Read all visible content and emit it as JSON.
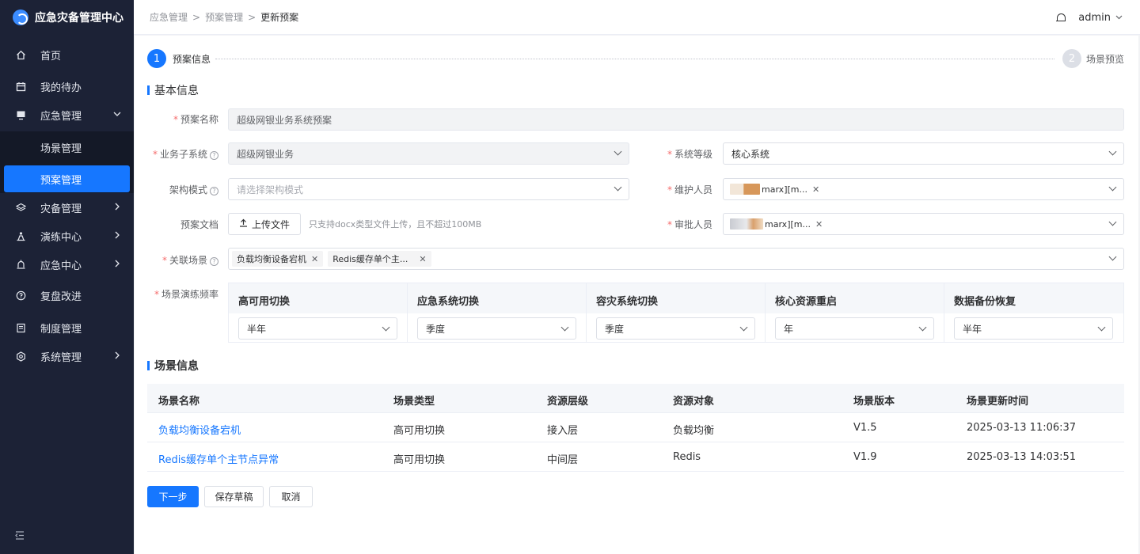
{
  "app": {
    "title": "应急灾备管理中心"
  },
  "sidebar": {
    "items": [
      {
        "label": "首页",
        "icon": "home-icon"
      },
      {
        "label": "我的待办",
        "icon": "calendar-icon"
      },
      {
        "label": "应急管理",
        "icon": "monitor-icon",
        "expanded": true
      },
      {
        "label": "灾备管理",
        "icon": "layers-icon"
      },
      {
        "label": "演练中心",
        "icon": "drill-icon"
      },
      {
        "label": "应急中心",
        "icon": "alarm-icon"
      },
      {
        "label": "复盘改进",
        "icon": "question-icon"
      },
      {
        "label": "制度管理",
        "icon": "document-icon"
      },
      {
        "label": "系统管理",
        "icon": "settings-icon"
      }
    ],
    "sub_items": [
      {
        "label": "场景管理",
        "active": false
      },
      {
        "label": "预案管理",
        "active": true
      }
    ]
  },
  "header": {
    "breadcrumb": [
      "应急管理",
      "预案管理",
      "更新预案"
    ],
    "user": "admin"
  },
  "steps": [
    {
      "num": "1",
      "label": "预案信息",
      "active": true
    },
    {
      "num": "2",
      "label": "场景预览",
      "active": false
    }
  ],
  "form": {
    "section_title": "基本信息",
    "plan_name": {
      "label": "预案名称",
      "value": "超级网银业务系统预案"
    },
    "business_subsystem": {
      "label": "业务子系统",
      "value": "超级网银业务"
    },
    "system_level": {
      "label": "系统等级",
      "value": "核心系统"
    },
    "architecture": {
      "label": "架构模式",
      "placeholder": "请选择架构模式"
    },
    "maintainer": {
      "label": "维护人员",
      "tag": "marx][m..."
    },
    "plan_doc": {
      "label": "预案文档",
      "button": "上传文件",
      "hint": "只支持docx类型文件上传，且不超过100MB"
    },
    "approver": {
      "label": "审批人员",
      "tag": "marx][m..."
    },
    "related_scenes": {
      "label": "关联场景",
      "tags": [
        "负载均衡设备宕机",
        "Redis缓存单个主..."
      ]
    },
    "drill_frequency": {
      "label": "场景演练频率",
      "columns": [
        {
          "header": "高可用切换",
          "value": "半年"
        },
        {
          "header": "应急系统切换",
          "value": "季度"
        },
        {
          "header": "容灾系统切换",
          "value": "季度"
        },
        {
          "header": "核心资源重启",
          "value": "年"
        },
        {
          "header": "数据备份恢复",
          "value": "半年"
        }
      ]
    }
  },
  "scene_info": {
    "section_title": "场景信息",
    "headers": [
      "场景名称",
      "场景类型",
      "资源层级",
      "资源对象",
      "场景版本",
      "场景更新时间"
    ],
    "rows": [
      [
        "负载均衡设备宕机",
        "高可用切换",
        "接入层",
        "负载均衡",
        "V1.5",
        "2025-03-13 11:06:37"
      ],
      [
        "Redis缓存单个主节点异常",
        "高可用切换",
        "中间层",
        "Redis",
        "V1.9",
        "2025-03-13 14:03:51"
      ]
    ]
  },
  "actions": {
    "next": "下一步",
    "save_draft": "保存草稿",
    "cancel": "取消"
  },
  "colors": {
    "primary": "#1677ff",
    "sidebar_bg": "#1c2236"
  }
}
